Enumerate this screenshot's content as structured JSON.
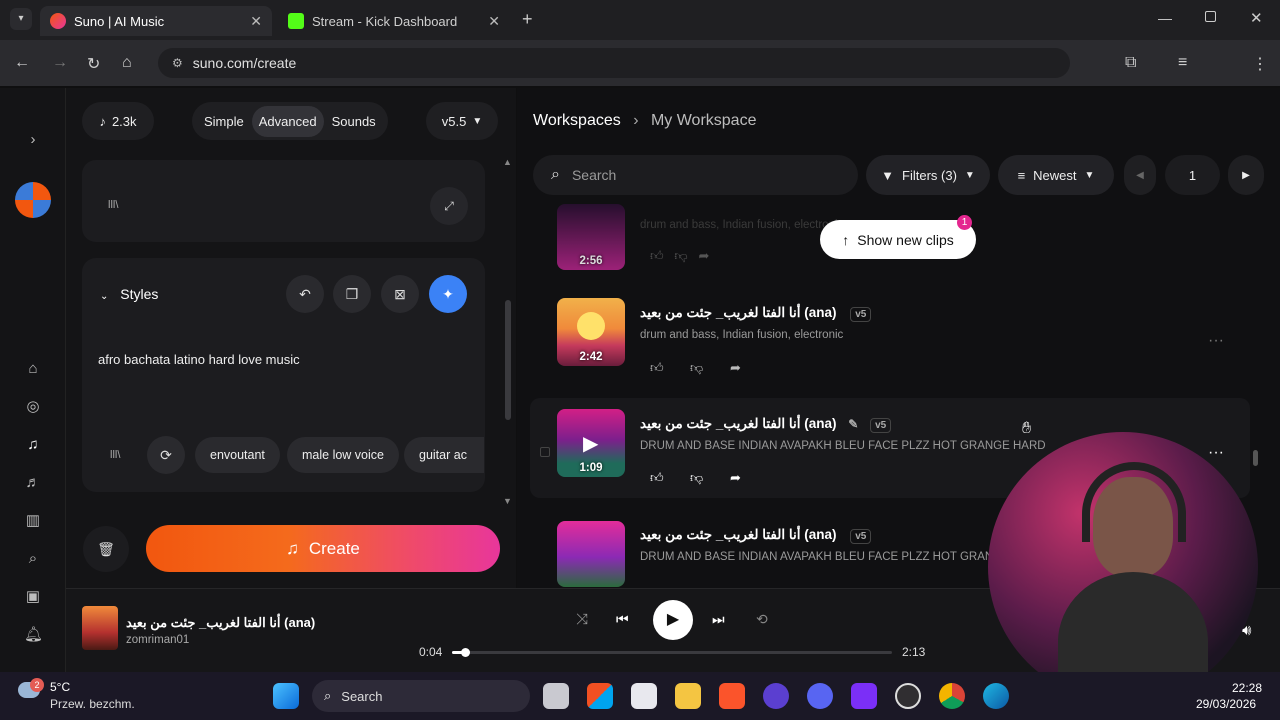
{
  "browser": {
    "tabs": [
      {
        "title": "Suno | AI Music",
        "active": true
      },
      {
        "title": "Stream - Kick Dashboard",
        "active": false
      }
    ],
    "url": "suno.com/create"
  },
  "left": {
    "credits": "2.3k",
    "modes": [
      "Simple",
      "Advanced",
      "Sounds"
    ],
    "active_mode": "Advanced",
    "version": "v5.5",
    "lyrics_icon_text": "lll\\",
    "styles_label": "Styles",
    "styles_text": "afro bachata latino hard  love music",
    "style_chips": [
      "envoutant",
      "male low voice",
      "guitar ac"
    ],
    "create_label": "Create"
  },
  "right": {
    "breadcrumb_root": "Workspaces",
    "breadcrumb_current": "My Workspace",
    "search_placeholder": "Search",
    "filters_label": "Filters (3)",
    "sort_label": "Newest",
    "page": "1",
    "new_clips_label": "Show new clips",
    "new_clips_count": "1",
    "clips": [
      {
        "duration": "2:56",
        "title": "",
        "tags": "drum and bass, Indian fusion, electronic"
      },
      {
        "duration": "2:42",
        "title": "أنا الفتا لغريب_ جئت من بعيد (ana)",
        "version": "v5",
        "tags": "drum and bass, Indian fusion, electronic"
      },
      {
        "duration": "1:09",
        "title": "أنا الفتا لغريب_ جئت من بعيد (ana)",
        "version": "v5",
        "tags": "DRUM AND BASE INDIAN AVAPAKH BLEU FACE PLZZ HOT GRANGE HARD"
      },
      {
        "duration": "",
        "title": "أنا الفتا لغريب_ جئت من بعيد (ana)",
        "version": "v5",
        "tags": "DRUM AND BASE INDIAN AVAPAKH BLEU FACE PLZZ HOT GRANGE HARD"
      }
    ]
  },
  "player": {
    "title": "أنا الفتا لغريب_ جئت من بعيد (ana)",
    "artist": "zomriman01",
    "current_time": "0:04",
    "total_time": "2:13",
    "progress": 0.03
  },
  "taskbar": {
    "weather_temp": "5°C",
    "weather_desc": "Przew. bezchm.",
    "weather_badge": "2",
    "search_label": "Search",
    "time": "22:28",
    "date": "29/03/2026"
  },
  "colors": {
    "accent": "#3b82f6",
    "create_start": "#f2570f",
    "create_end": "#e8369b"
  }
}
